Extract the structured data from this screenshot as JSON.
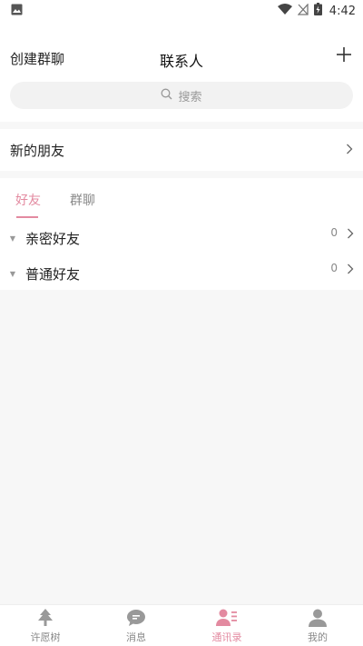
{
  "status_bar": {
    "time": "4:42",
    "icons": [
      "image-icon",
      "wifi-icon",
      "signal-off-icon",
      "battery-charging-icon"
    ]
  },
  "header": {
    "create_group_label": "创建群聊",
    "title": "联系人",
    "add_icon": "plus-icon"
  },
  "search": {
    "placeholder": "搜索",
    "icon": "search-icon"
  },
  "new_friends": {
    "label": "新的朋友"
  },
  "tabs": [
    {
      "label": "好友",
      "active": true
    },
    {
      "label": "群聊",
      "active": false
    }
  ],
  "groups": [
    {
      "name": "亲密好友",
      "count": "0"
    },
    {
      "name": "普通好友",
      "count": "0"
    }
  ],
  "bottom_nav": [
    {
      "label": "许愿树",
      "icon": "tree-icon",
      "active": false
    },
    {
      "label": "消息",
      "icon": "message-icon",
      "active": false
    },
    {
      "label": "通讯录",
      "icon": "contacts-icon",
      "active": true
    },
    {
      "label": "我的",
      "icon": "profile-icon",
      "active": false
    }
  ],
  "colors": {
    "accent": "#e38aa0",
    "inactive": "#888888",
    "background": "#f7f7f7"
  }
}
